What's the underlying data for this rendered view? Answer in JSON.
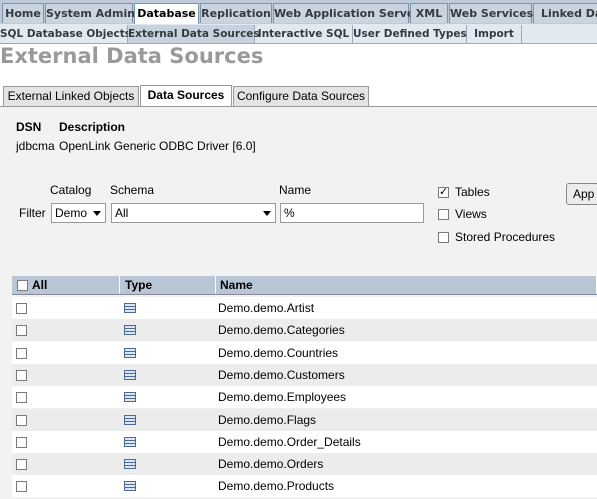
{
  "nav": {
    "tabs": [
      "Home",
      "System Admin",
      "Database",
      "Replication",
      "Web Application Server",
      "XML",
      "Web Services",
      "Linked Dat"
    ],
    "active": "Database"
  },
  "subnav": {
    "tabs": [
      "SQL Database Objects",
      "External Data Sources",
      "Interactive SQL",
      "User Defined Types",
      "Import"
    ],
    "active": "External Data Sources"
  },
  "page_title": "External Data Sources",
  "inner_tabs": {
    "tabs": [
      "External Linked Objects",
      "Data Sources",
      "Configure Data Sources"
    ],
    "active": "Data Sources"
  },
  "dsn": {
    "dsn_header": "DSN",
    "desc_header": "Description",
    "dsn_value": "jdbcma",
    "desc_value": "OpenLink Generic ODBC Driver [6.0]"
  },
  "filter": {
    "filter_label": "Filter",
    "catalog_label": "Catalog",
    "catalog_value": "Demo",
    "schema_label": "Schema",
    "schema_value": "All",
    "name_label": "Name",
    "name_value": "%",
    "tables_label": "Tables",
    "tables_checked": true,
    "views_label": "Views",
    "views_checked": false,
    "procs_label": "Stored Procedures",
    "procs_checked": false,
    "apply_label": "App"
  },
  "grid": {
    "col_all": "All",
    "col_type": "Type",
    "col_name": "Name",
    "rows": [
      {
        "type_icon": "table-icon",
        "name": "Demo.demo.Artist"
      },
      {
        "type_icon": "table-icon",
        "name": "Demo.demo.Categories"
      },
      {
        "type_icon": "table-icon",
        "name": "Demo.demo.Countries"
      },
      {
        "type_icon": "table-icon",
        "name": "Demo.demo.Customers"
      },
      {
        "type_icon": "table-icon",
        "name": "Demo.demo.Employees"
      },
      {
        "type_icon": "table-icon",
        "name": "Demo.demo.Flags"
      },
      {
        "type_icon": "table-icon",
        "name": "Demo.demo.Order_Details"
      },
      {
        "type_icon": "table-icon",
        "name": "Demo.demo.Orders"
      },
      {
        "type_icon": "table-icon",
        "name": "Demo.demo.Products"
      }
    ]
  },
  "colors": {
    "nav_bg": "#bccad9",
    "grid_header": "#b8c6d6",
    "title_gray": "#9a9a9a"
  }
}
